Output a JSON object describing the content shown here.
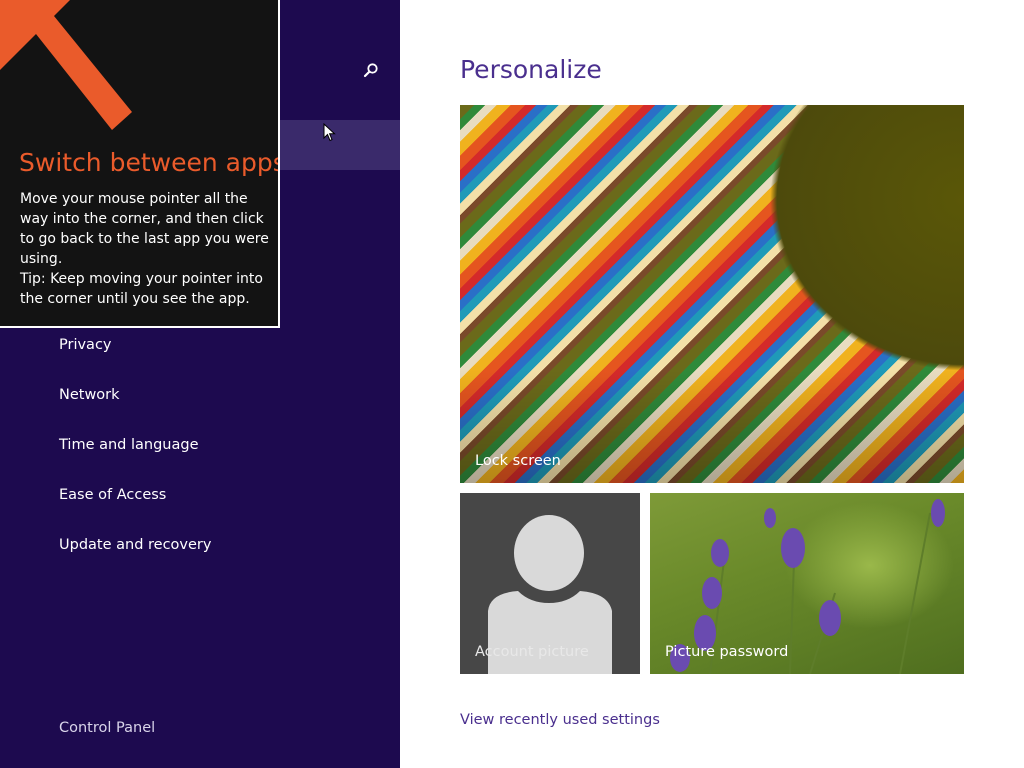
{
  "colors": {
    "nav_background": "#1d0a4f",
    "nav_selected": "#3a2a6b",
    "accent_purple": "#4a2f8e",
    "tip_background": "#131313",
    "tip_orange": "#ea5b2b"
  },
  "nav": {
    "search_icon": "search-icon",
    "items": [
      {
        "label": "Privacy"
      },
      {
        "label": "Network"
      },
      {
        "label": "Time and language"
      },
      {
        "label": "Ease of Access"
      },
      {
        "label": "Update and recovery"
      }
    ],
    "control_panel": "Control Panel"
  },
  "tip": {
    "arrow_icon": "arrow-up-left-icon",
    "title": "Switch between apps",
    "body": "Move your mouse pointer all the way into the corner, and then click to go back to the last app you were using.",
    "tip_text": "Tip: Keep moving your pointer into the corner until you see the app."
  },
  "main": {
    "title": "Personalize",
    "tiles": {
      "lock_screen": "Lock screen",
      "account_picture": "Account picture",
      "picture_password": "Picture password"
    },
    "view_recent": "View recently used settings"
  }
}
